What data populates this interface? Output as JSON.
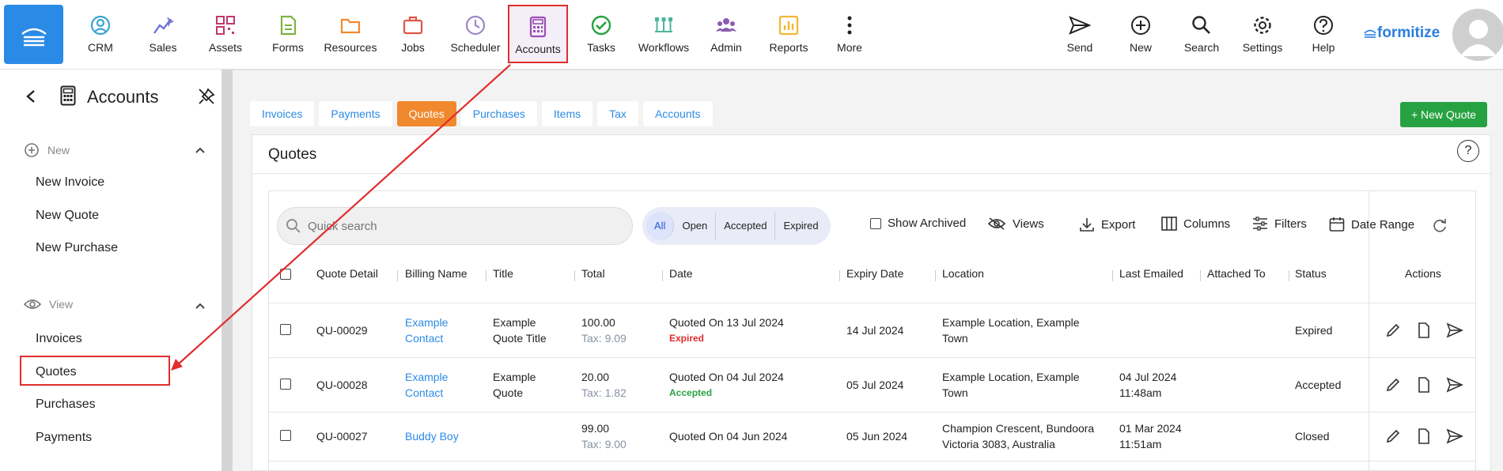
{
  "nav": {
    "items": [
      {
        "label": "CRM",
        "icon": "crm-icon"
      },
      {
        "label": "Sales",
        "icon": "sales-icon"
      },
      {
        "label": "Assets",
        "icon": "assets-icon"
      },
      {
        "label": "Forms",
        "icon": "forms-icon"
      },
      {
        "label": "Resources",
        "icon": "resources-icon"
      },
      {
        "label": "Jobs",
        "icon": "jobs-icon"
      },
      {
        "label": "Scheduler",
        "icon": "scheduler-icon"
      },
      {
        "label": "Accounts",
        "icon": "accounts-icon"
      },
      {
        "label": "Tasks",
        "icon": "tasks-icon"
      },
      {
        "label": "Workflows",
        "icon": "workflows-icon"
      },
      {
        "label": "Admin",
        "icon": "admin-icon"
      },
      {
        "label": "Reports",
        "icon": "reports-icon"
      },
      {
        "label": "More",
        "icon": "more-icon"
      }
    ],
    "right": [
      {
        "label": "Send",
        "icon": "send-icon"
      },
      {
        "label": "New",
        "icon": "plus-circle-icon"
      },
      {
        "label": "Search",
        "icon": "search-icon"
      },
      {
        "label": "Settings",
        "icon": "gear-icon"
      },
      {
        "label": "Help",
        "icon": "help-icon"
      }
    ],
    "logo": "formitize"
  },
  "sidebar": {
    "title": "Accounts",
    "new_section": "New",
    "new_links": [
      "New Invoice",
      "New Quote",
      "New Purchase"
    ],
    "view_section": "View",
    "view_links": [
      "Invoices",
      "Quotes",
      "Purchases",
      "Payments"
    ]
  },
  "tabs": [
    "Invoices",
    "Payments",
    "Quotes",
    "Purchases",
    "Items",
    "Tax",
    "Accounts"
  ],
  "new_quote_label": "+ New Quote",
  "panel": {
    "title": "Quotes",
    "search_placeholder": "Quick search",
    "filters": [
      "All",
      "Open",
      "Accepted",
      "Expired"
    ],
    "show_archived": "Show Archived",
    "views": "Views",
    "export": "Export",
    "columns": "Columns",
    "filters_label": "Filters",
    "date_range": "Date Range"
  },
  "table": {
    "headers": [
      "Quote Detail",
      "Billing Name",
      "Title",
      "Total",
      "Date",
      "Expiry Date",
      "Location",
      "Last Emailed",
      "Attached To",
      "Status",
      "Actions"
    ],
    "rows": [
      {
        "id": "QU-00029",
        "billing1": "Example",
        "billing2": "Contact",
        "title1": "Example",
        "title2": "Quote Title",
        "total": "100.00",
        "tax": "Tax: 9.09",
        "date": "Quoted On 13 Jul 2024",
        "badge": "Expired",
        "expiry": "14 Jul 2024",
        "loc1": "Example Location, Example",
        "loc2": "Town",
        "email1": "",
        "email2": "",
        "status": "Expired"
      },
      {
        "id": "QU-00028",
        "billing1": "Example",
        "billing2": "Contact",
        "title1": "Example",
        "title2": "Quote",
        "total": "20.00",
        "tax": "Tax: 1.82",
        "date": "Quoted On 04 Jul 2024",
        "badge": "Accepted",
        "expiry": "05 Jul 2024",
        "loc1": "Example Location, Example",
        "loc2": "Town",
        "email1": "04 Jul 2024",
        "email2": "11:48am",
        "status": "Accepted"
      },
      {
        "id": "QU-00027",
        "billing1": "Buddy Boy",
        "billing2": "",
        "title1": "",
        "title2": "",
        "total": "99.00",
        "tax": "Tax: 9.00",
        "date": "Quoted On 04 Jun 2024",
        "badge": "",
        "expiry": "05 Jun 2024",
        "loc1": "Champion Crescent, Bundoora",
        "loc2": "Victoria 3083, Australia",
        "email1": "01 Mar 2024",
        "email2": "11:51am",
        "status": "Closed"
      }
    ]
  }
}
